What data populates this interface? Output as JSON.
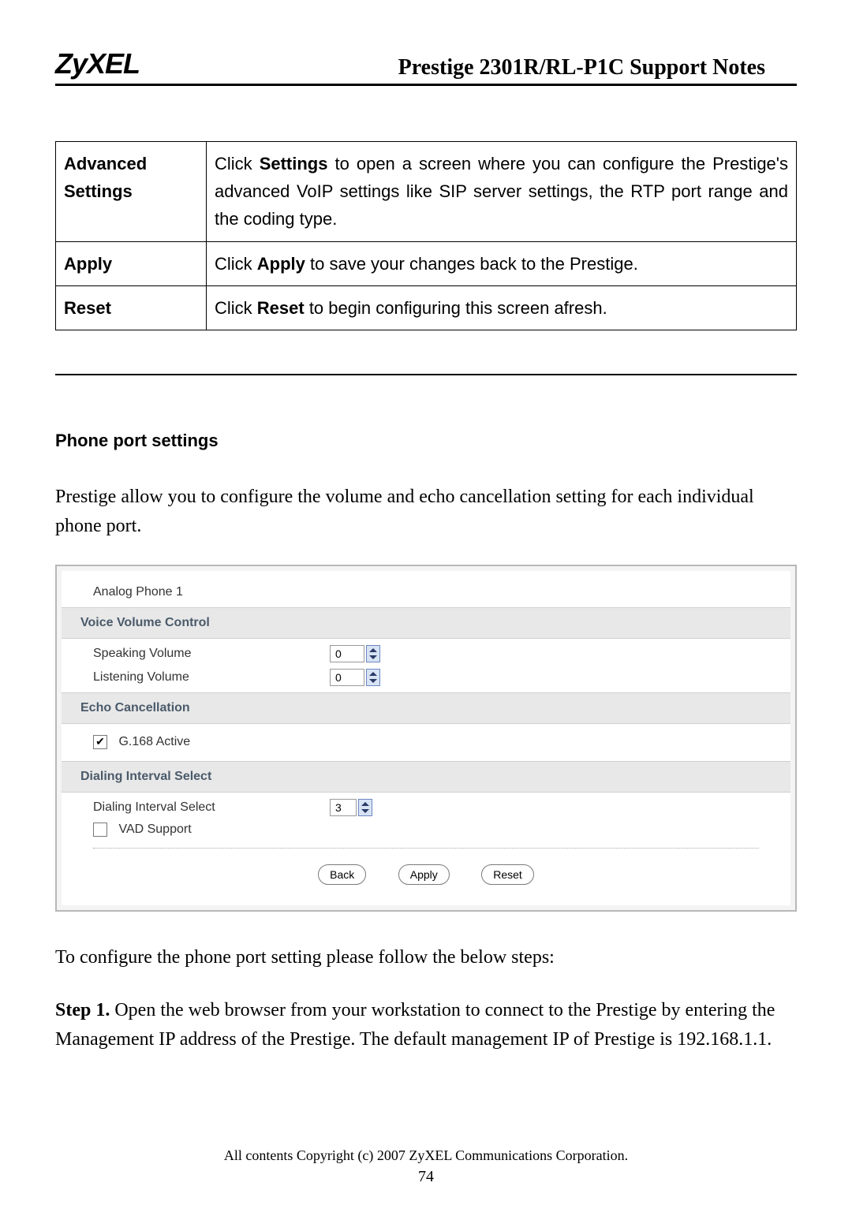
{
  "header": {
    "brand": "ZyXEL",
    "doc_title": "Prestige 2301R/RL-P1C Support Notes"
  },
  "table_rows": [
    {
      "label": "Advanced Settings",
      "pre": "Click ",
      "bold": "Settings",
      "post": " to open a screen where you can configure the Prestige's advanced VoIP settings like SIP server settings, the RTP port range and the coding type."
    },
    {
      "label": "Apply",
      "pre": "Click ",
      "bold": "Apply",
      "post": " to save your changes back to the Prestige."
    },
    {
      "label": "Reset",
      "pre": "Click ",
      "bold": "Reset",
      "post": " to begin configuring this screen afresh."
    }
  ],
  "section": {
    "title": "Phone port settings",
    "intro": "Prestige allow you to configure the volume and echo cancellation setting for each individual phone port."
  },
  "ui": {
    "title": "Analog Phone 1",
    "voice_header": "Voice Volume Control",
    "speaking_label": "Speaking Volume",
    "speaking_value": "0",
    "listening_label": "Listening Volume",
    "listening_value": "0",
    "echo_header": "Echo Cancellation",
    "g168_label": "G.168 Active",
    "g168_checked": true,
    "dialing_header": "Dialing Interval Select",
    "dialing_label": "Dialing Interval Select",
    "dialing_value": "3",
    "vad_label": "VAD Support",
    "vad_checked": false,
    "buttons": {
      "back": "Back",
      "apply": "Apply",
      "reset": "Reset"
    }
  },
  "steps": {
    "lead": "To configure the phone port setting please follow the below steps:",
    "step1_label": "Step 1.",
    "step1_text": " Open the web browser from your workstation to connect to the Prestige by entering the Management IP address of the Prestige.  The default management IP of Prestige is 192.168.1.1."
  },
  "footer": {
    "copyright": "All contents Copyright (c) 2007 ZyXEL Communications Corporation.",
    "page": "74"
  }
}
